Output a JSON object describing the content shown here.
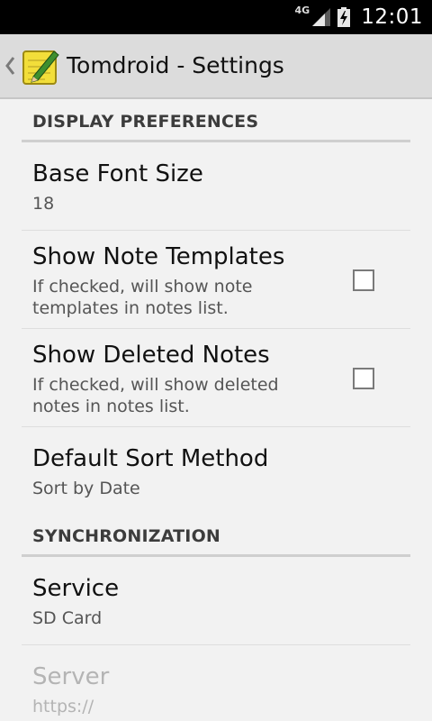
{
  "status_bar": {
    "network": "4G",
    "time": "12:01"
  },
  "action_bar": {
    "title": "Tomdroid - Settings"
  },
  "categories": [
    {
      "label": "DISPLAY PREFERENCES",
      "items": [
        {
          "title": "Base Font Size",
          "summary": "18"
        },
        {
          "title": "Show Note Templates",
          "summary": "If checked, will show note templates in notes list.",
          "checked": false
        },
        {
          "title": "Show Deleted Notes",
          "summary": "If checked, will show deleted notes in notes list.",
          "checked": false
        },
        {
          "title": "Default Sort Method",
          "summary": "Sort by Date"
        }
      ]
    },
    {
      "label": "SYNCHRONIZATION",
      "items": [
        {
          "title": "Service",
          "summary": "SD Card"
        },
        {
          "title": "Server",
          "summary": "https://",
          "enabled": false
        }
      ]
    }
  ],
  "colors": {
    "background": "#f2f2f2",
    "action_bar": "#dcdcdc",
    "status_bar": "#000000",
    "disabled_text": "#b4b4b4"
  }
}
